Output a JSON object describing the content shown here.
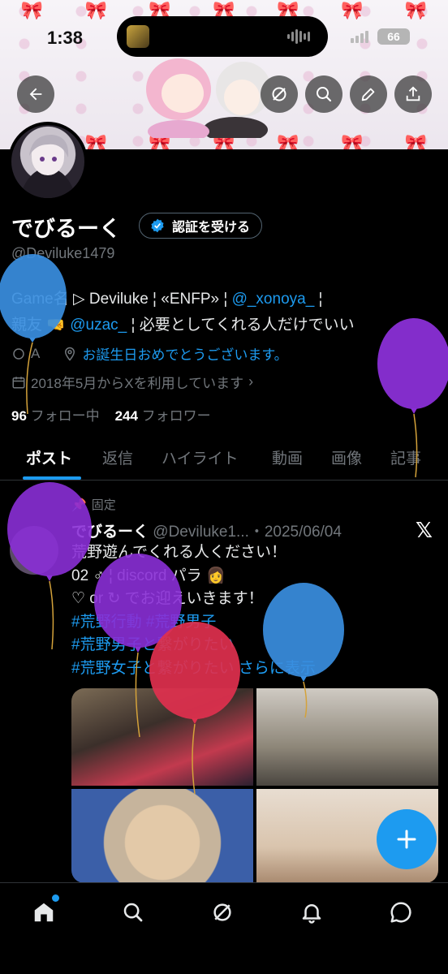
{
  "status_bar": {
    "time": "1:38",
    "battery": "66"
  },
  "profile": {
    "name": "でびるーく",
    "verify_button": "認証を受ける",
    "handle": "@Deviluke1479",
    "bio_line1_prefix": "Game名 ▷ Deviluke ¦ «ENFP» ¦ ",
    "bio_line1_link": "@_xonoya_",
    "bio_line1_suffix": " ¦",
    "bio_line2_prefix": "親友 🤜 ",
    "bio_line2_link": "@uzac_",
    "bio_line2_suffix": " ¦ 必要としてくれる人だけでいい",
    "location": "A",
    "birthday_text": "お誕生日おめでとうございます。",
    "joined": "2018年5月からXを利用しています",
    "following_count": "96",
    "following_label": "フォロー中",
    "followers_count": "244",
    "followers_label": "フォロワー"
  },
  "tabs": [
    {
      "label": "ポスト",
      "active": true
    },
    {
      "label": "返信",
      "active": false
    },
    {
      "label": "ハイライト",
      "active": false
    },
    {
      "label": "動画",
      "active": false
    },
    {
      "label": "画像",
      "active": false
    },
    {
      "label": "記事",
      "active": false
    }
  ],
  "post": {
    "pinned_label": "固定",
    "author": "でびるーく",
    "handle_date": "@Deviluke1...・2025/06/04",
    "line1": "荒野遊んでくれる人ください！",
    "line2": "02 ♂ ¦ discord パラ 👩",
    "line3": "♡ or ↻ でお迎えいきます！",
    "tag_line1": "#荒野行動 #荒野男子",
    "tag_line2": "#荒野男子と繋がりたい",
    "tag_line3": "#荒野女子と繋がりたい さらに表示"
  },
  "colors": {
    "accent": "#1d9bf0",
    "balloon_blue": "#3a8ee0",
    "balloon_purple": "#8a2fd6",
    "balloon_red": "#e0304e"
  }
}
